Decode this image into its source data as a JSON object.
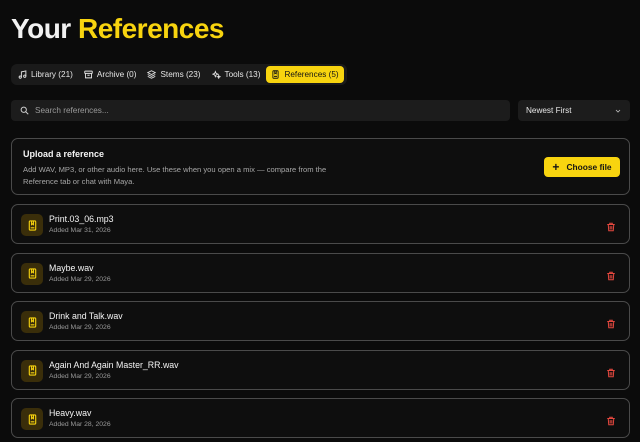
{
  "header": {
    "title_prefix": "Your",
    "title_accent": "References"
  },
  "tabs": [
    {
      "label": "Library (21)",
      "icon": "music-note-icon"
    },
    {
      "label": "Archive (0)",
      "icon": "archive-box-icon"
    },
    {
      "label": "Stems (23)",
      "icon": "layers-icon"
    },
    {
      "label": "Tools (13)",
      "icon": "sparkles-icon"
    },
    {
      "label": "References (5)",
      "icon": "bookmark-book-icon",
      "active": true
    }
  ],
  "search": {
    "placeholder": "Search references...",
    "value": ""
  },
  "sort": {
    "selected": "Newest First"
  },
  "upload": {
    "title": "Upload a reference",
    "description": "Add WAV, MP3, or other audio here. Use these when you open a mix — compare from the Reference tab or chat with Maya.",
    "button_label": "Choose file"
  },
  "references": [
    {
      "name": "Print.03_06.mp3",
      "added": "Added Mar 31, 2026"
    },
    {
      "name": "Maybe.wav",
      "added": "Added Mar 29, 2026"
    },
    {
      "name": "Drink and Talk.wav",
      "added": "Added Mar 29, 2026"
    },
    {
      "name": "Again And Again Master_RR.wav",
      "added": "Added Mar 29, 2026"
    },
    {
      "name": "Heavy.wav",
      "added": "Added Mar 28, 2026"
    }
  ],
  "colors": {
    "accent": "#f8d40f",
    "background": "#0b0b0b",
    "delete": "#e5483f"
  }
}
